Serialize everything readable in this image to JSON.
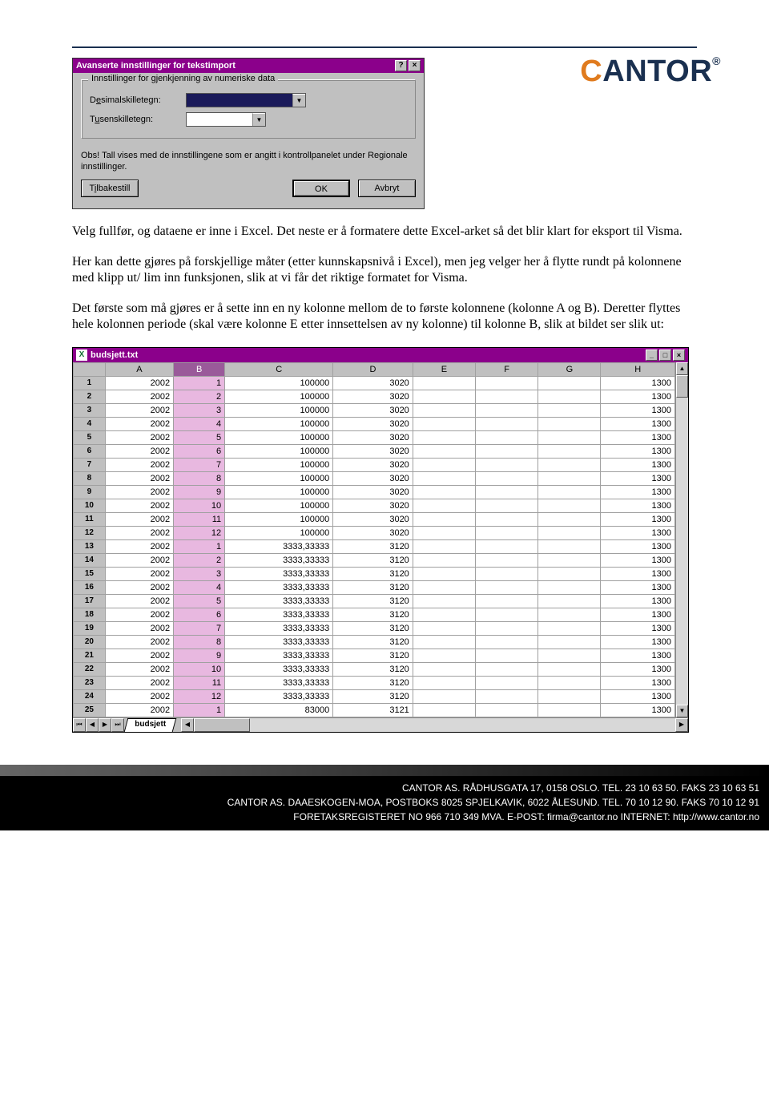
{
  "logo": {
    "text1": "C",
    "text2": "ANTOR",
    "reg": "®"
  },
  "dialog": {
    "title": "Avanserte innstillinger for tekstimport",
    "help_btn": "?",
    "close_btn": "×",
    "fieldset_legend": "Innstillinger for gjenkjenning av numeriske data",
    "decimal_label_pre": "D",
    "decimal_label_u": "e",
    "decimal_label_post": "simalskilletegn:",
    "thousand_label_pre": "T",
    "thousand_label_u": "u",
    "thousand_label_post": "senskilletegn:",
    "note": "Obs! Tall vises med de innstillingene som er angitt i kontrollpanelet under Regionale innstillinger.",
    "reset_pre": "T",
    "reset_u": "i",
    "reset_post": "lbakestill",
    "ok": "OK",
    "cancel": "Avbryt"
  },
  "paragraphs": {
    "p1": "Velg fullfør, og dataene er inne i Excel. Det neste er å formatere dette Excel-arket så det blir klart for eksport til Visma.",
    "p2": "Her kan dette gjøres på forskjellige måter (etter kunnskapsnivå i Excel), men jeg velger her å flytte rundt på kolonnene med klipp ut/ lim inn funksjonen, slik at vi får det riktige formatet for Visma.",
    "p3": "Det første som må gjøres er å sette inn en ny kolonne mellom de to første kolonnene (kolonne A og B). Deretter flyttes hele kolonnen periode (skal være kolonne E etter innsettelsen av ny kolonne) til kolonne B, slik at bildet ser slik ut:"
  },
  "excel": {
    "title": "budsjett.txt",
    "min_btn": "_",
    "max_btn": "□",
    "close_btn": "×",
    "columns": [
      "A",
      "B",
      "C",
      "D",
      "E",
      "F",
      "G",
      "H"
    ],
    "sheet_tab": "budsjett",
    "rows": [
      {
        "n": 1,
        "A": "2002",
        "B": "1",
        "C": "100000",
        "D": "3020",
        "H": "1300"
      },
      {
        "n": 2,
        "A": "2002",
        "B": "2",
        "C": "100000",
        "D": "3020",
        "H": "1300"
      },
      {
        "n": 3,
        "A": "2002",
        "B": "3",
        "C": "100000",
        "D": "3020",
        "H": "1300"
      },
      {
        "n": 4,
        "A": "2002",
        "B": "4",
        "C": "100000",
        "D": "3020",
        "H": "1300"
      },
      {
        "n": 5,
        "A": "2002",
        "B": "5",
        "C": "100000",
        "D": "3020",
        "H": "1300"
      },
      {
        "n": 6,
        "A": "2002",
        "B": "6",
        "C": "100000",
        "D": "3020",
        "H": "1300"
      },
      {
        "n": 7,
        "A": "2002",
        "B": "7",
        "C": "100000",
        "D": "3020",
        "H": "1300"
      },
      {
        "n": 8,
        "A": "2002",
        "B": "8",
        "C": "100000",
        "D": "3020",
        "H": "1300"
      },
      {
        "n": 9,
        "A": "2002",
        "B": "9",
        "C": "100000",
        "D": "3020",
        "H": "1300"
      },
      {
        "n": 10,
        "A": "2002",
        "B": "10",
        "C": "100000",
        "D": "3020",
        "H": "1300"
      },
      {
        "n": 11,
        "A": "2002",
        "B": "11",
        "C": "100000",
        "D": "3020",
        "H": "1300"
      },
      {
        "n": 12,
        "A": "2002",
        "B": "12",
        "C": "100000",
        "D": "3020",
        "H": "1300"
      },
      {
        "n": 13,
        "A": "2002",
        "B": "1",
        "C": "3333,33333",
        "D": "3120",
        "H": "1300"
      },
      {
        "n": 14,
        "A": "2002",
        "B": "2",
        "C": "3333,33333",
        "D": "3120",
        "H": "1300"
      },
      {
        "n": 15,
        "A": "2002",
        "B": "3",
        "C": "3333,33333",
        "D": "3120",
        "H": "1300"
      },
      {
        "n": 16,
        "A": "2002",
        "B": "4",
        "C": "3333,33333",
        "D": "3120",
        "H": "1300"
      },
      {
        "n": 17,
        "A": "2002",
        "B": "5",
        "C": "3333,33333",
        "D": "3120",
        "H": "1300"
      },
      {
        "n": 18,
        "A": "2002",
        "B": "6",
        "C": "3333,33333",
        "D": "3120",
        "H": "1300"
      },
      {
        "n": 19,
        "A": "2002",
        "B": "7",
        "C": "3333,33333",
        "D": "3120",
        "H": "1300"
      },
      {
        "n": 20,
        "A": "2002",
        "B": "8",
        "C": "3333,33333",
        "D": "3120",
        "H": "1300"
      },
      {
        "n": 21,
        "A": "2002",
        "B": "9",
        "C": "3333,33333",
        "D": "3120",
        "H": "1300"
      },
      {
        "n": 22,
        "A": "2002",
        "B": "10",
        "C": "3333,33333",
        "D": "3120",
        "H": "1300"
      },
      {
        "n": 23,
        "A": "2002",
        "B": "11",
        "C": "3333,33333",
        "D": "3120",
        "H": "1300"
      },
      {
        "n": 24,
        "A": "2002",
        "B": "12",
        "C": "3333,33333",
        "D": "3120",
        "H": "1300"
      },
      {
        "n": 25,
        "A": "2002",
        "B": "1",
        "C": "83000",
        "D": "3121",
        "H": "1300"
      }
    ]
  },
  "footer": {
    "line1": "CANTOR AS. RÅDHUSGATA 17, 0158  OSLO. TEL. 23 10 63 50. FAKS 23 10 63 51",
    "line2": "CANTOR AS. DAAESKOGEN-MOA, POSTBOKS 8025 SPJELKAVIK, 6022 ÅLESUND. TEL. 70 10 12 90. FAKS 70 10 12 91",
    "line3": "FORETAKSREGISTERET NO 966 710 349 MVA. E-POST: firma@cantor.no INTERNET: http://www.cantor.no"
  }
}
